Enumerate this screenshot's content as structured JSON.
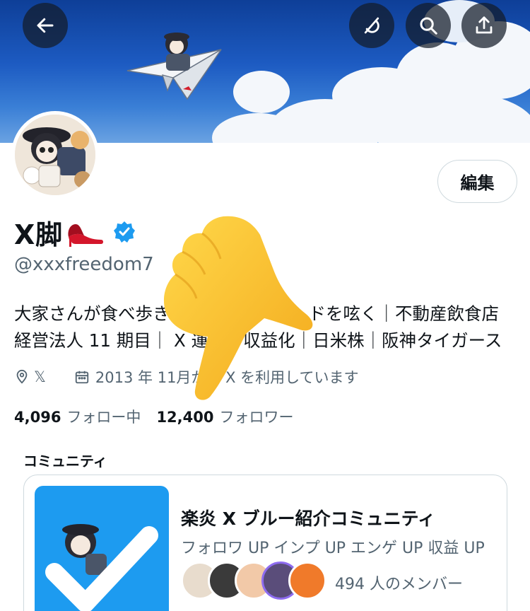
{
  "header": {
    "back_icon": "arrow-left-icon",
    "top_right_icons": [
      "grok-icon",
      "search-icon",
      "share-icon"
    ]
  },
  "profile": {
    "edit_label": "編集",
    "display_name": "X脚",
    "name_emoji": "high-heel-icon",
    "verified_color": "#1d9bf0",
    "handle": "@xxxfreedom7",
    "bio_lines": [
      "大家さんが食べ歩き　　　　　　マ　ドを呟く｜不動産飲食店",
      "経営法人 11 期目｜ X 運　　収益化｜日米株｜阪神タイガース"
    ],
    "location": "𝕏",
    "joined": "2013 年 11月か　 X を利用しています",
    "following_count": "4,096",
    "following_label": "フォロー中",
    "followers_count": "12,400",
    "followers_label": "フォロワー"
  },
  "communities": {
    "title": "コミュニティ",
    "card": {
      "name": "楽炎 X ブルー紹介コミュニティ",
      "description": "フォロワ UP インプ UP エンゲ UP  収益 UP",
      "member_count": "494 人のメンバー"
    }
  },
  "colors": {
    "accent": "#1d9bf0",
    "text_secondary": "#536471",
    "border": "#cfd9de"
  }
}
